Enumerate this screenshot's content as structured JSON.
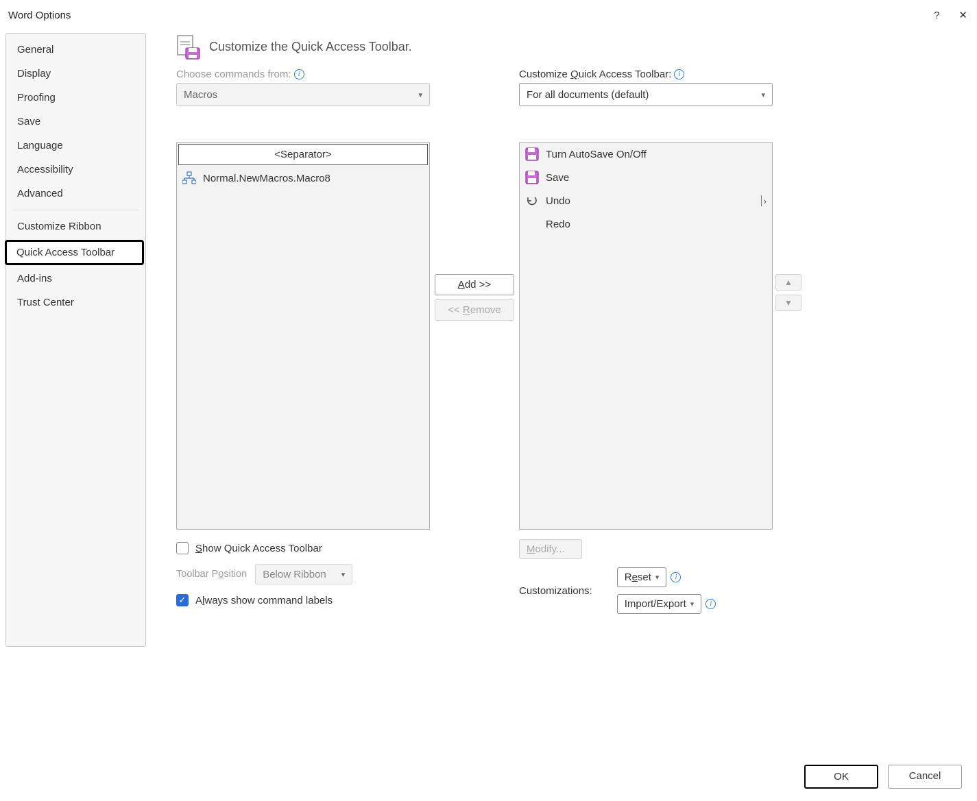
{
  "window": {
    "title": "Word Options",
    "help": "?",
    "close": "✕"
  },
  "sidebar": {
    "items": [
      {
        "label": "General"
      },
      {
        "label": "Display"
      },
      {
        "label": "Proofing"
      },
      {
        "label": "Save"
      },
      {
        "label": "Language"
      },
      {
        "label": "Accessibility"
      },
      {
        "label": "Advanced"
      }
    ],
    "items2": [
      {
        "label": "Customize Ribbon"
      },
      {
        "label": "Quick Access Toolbar",
        "selected": true
      }
    ],
    "items3": [
      {
        "label": "Add-ins"
      },
      {
        "label": "Trust Center"
      }
    ]
  },
  "header": {
    "title": "Customize the Quick Access Toolbar."
  },
  "left": {
    "choose_label": "Choose commands from:",
    "choose_value": "Macros",
    "list": {
      "separator": "<Separator>",
      "items": [
        {
          "icon": "macro-icon",
          "label": "Normal.NewMacros.Macro8"
        }
      ]
    }
  },
  "mid": {
    "add": "Add >>",
    "remove": "<< Remove"
  },
  "right": {
    "customize_label": "Customize Quick Access Toolbar:",
    "customize_value": "For all documents (default)",
    "list": {
      "items": [
        {
          "icon": "autosave-icon",
          "label": "Turn AutoSave On/Off"
        },
        {
          "icon": "save-icon",
          "label": "Save"
        },
        {
          "icon": "undo-icon",
          "label": "Undo",
          "expandable": true
        },
        {
          "icon": "redo-blank-icon",
          "label": "Redo"
        }
      ]
    },
    "modify": "Modify...",
    "customizations_label": "Customizations:",
    "reset": "Reset",
    "import_export": "Import/Export"
  },
  "below_left": {
    "show_qat": "Show Quick Access Toolbar",
    "show_qat_checked": false,
    "position_label": "Toolbar Position",
    "position_value": "Below Ribbon",
    "always_show": "Always show command labels",
    "always_show_checked": true
  },
  "far": {
    "up": "▲",
    "down": "▼"
  },
  "footer": {
    "ok": "OK",
    "cancel": "Cancel"
  }
}
